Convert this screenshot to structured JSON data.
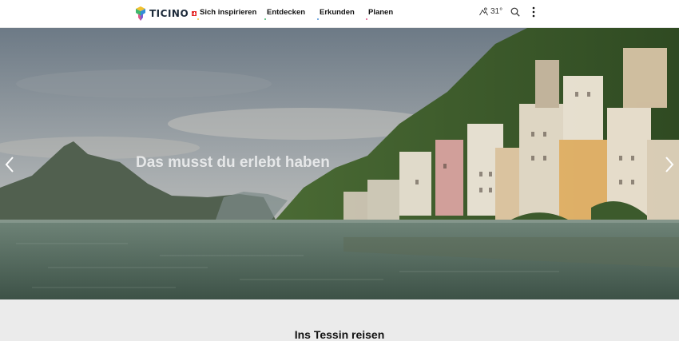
{
  "header": {
    "logo_text": "TICINO",
    "nav": [
      {
        "label": "Sich inspirieren",
        "dot": "#f0c23a"
      },
      {
        "label": "Entdecken",
        "dot": "#3fb66c"
      },
      {
        "label": "Erkunden",
        "dot": "#4a90d9"
      },
      {
        "label": "Planen",
        "dot": "#e2578a"
      }
    ],
    "weather": {
      "icon": "mountain-sun-icon",
      "temperature": "31°"
    },
    "search_icon": "search-icon",
    "more_icon": "more-vertical-icon"
  },
  "hero": {
    "title": "Das musst du erlebt haben",
    "prev_icon": "chevron-left-icon",
    "next_icon": "chevron-right-icon"
  },
  "section": {
    "title": "Ins Tessin reisen"
  },
  "colors": {
    "accent_yellow": "#f0c23a",
    "accent_green": "#3fb66c",
    "accent_blue": "#4a90d9",
    "accent_pink": "#e2578a",
    "flag_red": "#e52b2b",
    "section_bg": "#ebebeb"
  }
}
